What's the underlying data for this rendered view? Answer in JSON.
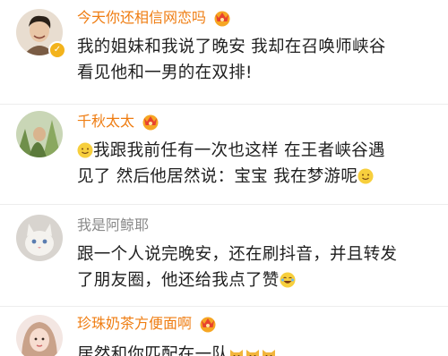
{
  "comments": [
    {
      "username": "今天你还相信网恋吗",
      "line1": "我的姐妹和我说了晚安 我却在召唤师峡谷",
      "line2": "看见他和一男的在双排!"
    },
    {
      "username": "千秋太太",
      "line1": "我跟我前任有一次也这样 在王者峡谷遇",
      "line2": "见了 然后他居然说：宝宝 我在梦游呢"
    },
    {
      "username": "我是阿鲸耶",
      "line1": "跟一个人说完晚安，还在刷抖音，并且转发",
      "line2": "了朋友圈，他还给我点了赞"
    },
    {
      "username": "珍珠奶茶方便面啊",
      "line1": "居然和你匹配在一队"
    }
  ],
  "colors": {
    "vip_name": "#ef7d12",
    "normal_name": "#8a8a8a",
    "text": "#1f1f1f",
    "verified_badge": "#f3b31c"
  },
  "icons": [
    "crown-icon",
    "smile-emoji-icon",
    "laugh-emoji-icon",
    "cat-emoji-icon",
    "verified-badge-icon"
  ]
}
